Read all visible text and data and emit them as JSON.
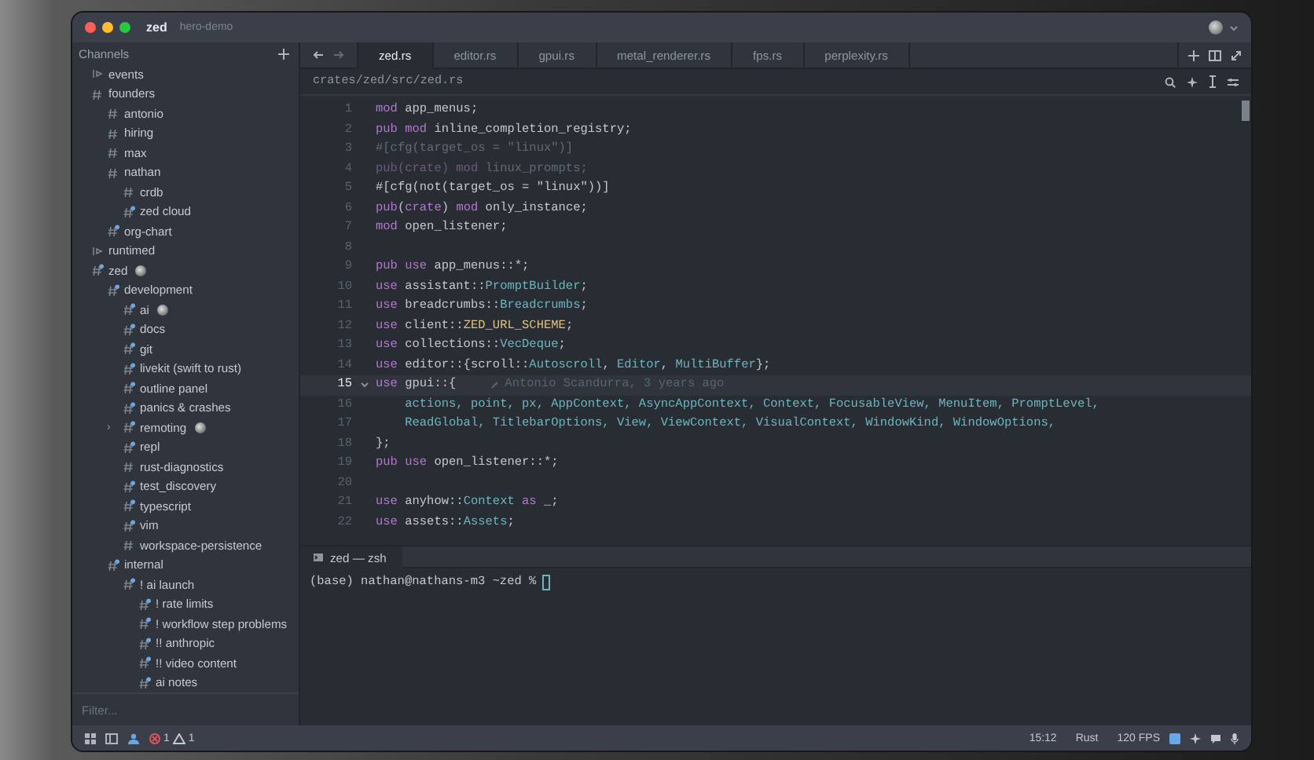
{
  "window": {
    "app": "zed",
    "project": "hero-demo"
  },
  "sidebar": {
    "title": "Channels",
    "filter_placeholder": "Filter...",
    "channels": [
      {
        "name": "events",
        "kind": "feed",
        "marked": false
      },
      {
        "name": "founders",
        "kind": "channel",
        "marked": false,
        "children": [
          {
            "name": "antonio",
            "kind": "channel",
            "marked": false
          },
          {
            "name": "hiring",
            "kind": "channel",
            "marked": false
          },
          {
            "name": "max",
            "kind": "channel",
            "marked": false
          },
          {
            "name": "nathan",
            "kind": "channel",
            "marked": false,
            "children": [
              {
                "name": "crdb",
                "kind": "channel",
                "marked": false
              },
              {
                "name": "zed cloud",
                "kind": "channel",
                "marked": true
              }
            ]
          },
          {
            "name": "org-chart",
            "kind": "channel",
            "marked": true
          }
        ]
      },
      {
        "name": "runtimed",
        "kind": "feed",
        "marked": false
      },
      {
        "name": "zed",
        "kind": "channel",
        "marked": true,
        "avatar": true,
        "children": [
          {
            "name": "development",
            "kind": "channel",
            "marked": true,
            "children": [
              {
                "name": "ai",
                "kind": "channel",
                "marked": true,
                "avatar": true
              },
              {
                "name": "docs",
                "kind": "channel",
                "marked": true
              },
              {
                "name": "git",
                "kind": "channel",
                "marked": true
              },
              {
                "name": "livekit (swift to rust)",
                "kind": "channel",
                "marked": true
              },
              {
                "name": "outline panel",
                "kind": "channel",
                "marked": true
              },
              {
                "name": "panics & crashes",
                "kind": "channel",
                "marked": true
              },
              {
                "name": "remoting",
                "kind": "channel",
                "marked": true,
                "avatar": true,
                "chevron": "›"
              },
              {
                "name": "repl",
                "kind": "channel",
                "marked": true
              },
              {
                "name": "rust-diagnostics",
                "kind": "channel",
                "marked": false
              },
              {
                "name": "test_discovery",
                "kind": "channel",
                "marked": true
              },
              {
                "name": "typescript",
                "kind": "channel",
                "marked": true
              },
              {
                "name": "vim",
                "kind": "channel",
                "marked": true
              },
              {
                "name": "workspace-persistence",
                "kind": "channel",
                "marked": false
              }
            ]
          },
          {
            "name": "internal",
            "kind": "channel",
            "marked": true,
            "children": [
              {
                "name": "! ai launch",
                "kind": "channel",
                "marked": true,
                "children": [
                  {
                    "name": "! rate limits",
                    "kind": "channel",
                    "marked": true
                  },
                  {
                    "name": "! workflow step problems",
                    "kind": "channel",
                    "marked": true
                  },
                  {
                    "name": "!! anthropic",
                    "kind": "channel",
                    "marked": true
                  },
                  {
                    "name": "!! video content",
                    "kind": "channel",
                    "marked": true
                  },
                  {
                    "name": "ai notes",
                    "kind": "channel",
                    "marked": true
                  }
                ]
              }
            ]
          }
        ]
      }
    ]
  },
  "editor": {
    "tabs": [
      {
        "label": "zed.rs",
        "selected": true
      },
      {
        "label": "editor.rs",
        "selected": false
      },
      {
        "label": "gpui.rs",
        "selected": false
      },
      {
        "label": "metal_renderer.rs",
        "selected": false
      },
      {
        "label": "fps.rs",
        "selected": false
      },
      {
        "label": "perplexity.rs",
        "selected": false
      }
    ],
    "breadcrumb": "crates/zed/src/zed.rs",
    "lines": [
      {
        "n": "1",
        "current": false,
        "tokens": [
          {
            "kind": "keyword",
            "text": "mod"
          },
          {
            "kind": "plain",
            "text": " app_menus;"
          }
        ]
      },
      {
        "n": "2",
        "current": false,
        "tokens": [
          {
            "kind": "keyword",
            "text": "pub mod"
          },
          {
            "kind": "plain",
            "text": " inline_completion_registry;"
          }
        ]
      },
      {
        "n": "3",
        "current": false,
        "tokens": [
          {
            "kind": "inactive",
            "text": "#[cfg(target_os = \"linux\")]"
          }
        ]
      },
      {
        "n": "4",
        "current": false,
        "tokens": [
          {
            "kind": "inactive_keyword",
            "text": "pub(crate) mod"
          },
          {
            "kind": "inactive",
            "text": " linux_prompts;"
          }
        ]
      },
      {
        "n": "5",
        "current": false,
        "tokens": [
          {
            "kind": "plain",
            "text": "#[cfg(not(target_os = \"linux\"))]"
          }
        ]
      },
      {
        "n": "6",
        "current": false,
        "tokens": [
          {
            "kind": "keyword",
            "text": "pub"
          },
          {
            "kind": "plain",
            "text": "("
          },
          {
            "kind": "keyword",
            "text": "crate"
          },
          {
            "kind": "plain",
            "text": ") "
          },
          {
            "kind": "keyword",
            "text": "mod"
          },
          {
            "kind": "plain",
            "text": " only_instance;"
          }
        ]
      },
      {
        "n": "7",
        "current": false,
        "tokens": [
          {
            "kind": "keyword",
            "text": "mod"
          },
          {
            "kind": "plain",
            "text": " open_listener;"
          }
        ]
      },
      {
        "n": "8",
        "current": false
      },
      {
        "n": "9",
        "current": false,
        "tokens": [
          {
            "kind": "keyword",
            "text": "pub use"
          },
          {
            "kind": "plain",
            "text": " app_menus::*;"
          }
        ]
      },
      {
        "n": "10",
        "current": false,
        "tokens": [
          {
            "kind": "keyword",
            "text": "use"
          },
          {
            "kind": "plain",
            "text": " assistant::"
          },
          {
            "kind": "type",
            "text": "PromptBuilder"
          },
          {
            "kind": "plain",
            "text": ";"
          }
        ]
      },
      {
        "n": "11",
        "current": false,
        "tokens": [
          {
            "kind": "keyword",
            "text": "use"
          },
          {
            "kind": "plain",
            "text": " breadcrumbs::"
          },
          {
            "kind": "type",
            "text": "Breadcrumbs"
          },
          {
            "kind": "plain",
            "text": ";"
          }
        ]
      },
      {
        "n": "12",
        "current": false,
        "tokens": [
          {
            "kind": "keyword",
            "text": "use"
          },
          {
            "kind": "plain",
            "text": " client::"
          },
          {
            "kind": "constant",
            "text": "ZED_URL_SCHEME"
          },
          {
            "kind": "plain",
            "text": ";"
          }
        ]
      },
      {
        "n": "13",
        "current": false,
        "tokens": [
          {
            "kind": "keyword",
            "text": "use"
          },
          {
            "kind": "plain",
            "text": " collections::"
          },
          {
            "kind": "type",
            "text": "VecDeque"
          },
          {
            "kind": "plain",
            "text": ";"
          }
        ]
      },
      {
        "n": "14",
        "current": false,
        "tokens": [
          {
            "kind": "keyword",
            "text": "use"
          },
          {
            "kind": "plain",
            "text": " editor::{scroll::"
          },
          {
            "kind": "type",
            "text": "Autoscroll"
          },
          {
            "kind": "plain",
            "text": ", "
          },
          {
            "kind": "type",
            "text": "Editor"
          },
          {
            "kind": "plain",
            "text": ", "
          },
          {
            "kind": "type",
            "text": "MultiBuffer"
          },
          {
            "kind": "plain",
            "text": "};"
          }
        ]
      },
      {
        "n": "15",
        "current": true,
        "fold": true,
        "blame": "Antonio Scandurra, 3 years ago",
        "tokens": [
          {
            "kind": "keyword",
            "text": "use"
          },
          {
            "kind": "plain",
            "text": " gpui::{"
          }
        ]
      },
      {
        "n": "16",
        "current": false,
        "tokens": [
          {
            "kind": "type",
            "text": "    actions, point, px, AppContext, AsyncAppContext, Context, FocusableView, MenuItem, PromptLevel,"
          }
        ]
      },
      {
        "n": "17",
        "current": false,
        "tokens": [
          {
            "kind": "type",
            "text": "    ReadGlobal, TitlebarOptions, View, ViewContext, VisualContext, WindowKind, WindowOptions,"
          }
        ]
      },
      {
        "n": "18",
        "current": false,
        "tokens": [
          {
            "kind": "plain",
            "text": "};"
          }
        ]
      },
      {
        "n": "19",
        "current": false,
        "tokens": [
          {
            "kind": "keyword",
            "text": "pub use"
          },
          {
            "kind": "plain",
            "text": " open_listener::*;"
          }
        ]
      },
      {
        "n": "20",
        "current": false
      },
      {
        "n": "21",
        "current": false,
        "tokens": [
          {
            "kind": "keyword",
            "text": "use"
          },
          {
            "kind": "plain",
            "text": " anyhow::"
          },
          {
            "kind": "type",
            "text": "Context"
          },
          {
            "kind": "keyword",
            "text": " as"
          },
          {
            "kind": "plain",
            "text": " _;"
          }
        ]
      },
      {
        "n": "22",
        "current": false,
        "tokens": [
          {
            "kind": "keyword",
            "text": "use"
          },
          {
            "kind": "plain",
            "text": " assets::"
          },
          {
            "kind": "type",
            "text": "Assets"
          },
          {
            "kind": "plain",
            "text": ";"
          }
        ]
      }
    ]
  },
  "terminal": {
    "tab": "zed — zsh",
    "prompt": "(base) nathan@nathans-m3 ~zed %"
  },
  "status_bar": {
    "errors": "1",
    "warnings": "1",
    "cursor": "15:12",
    "language": "Rust",
    "fps": "120 FPS"
  }
}
